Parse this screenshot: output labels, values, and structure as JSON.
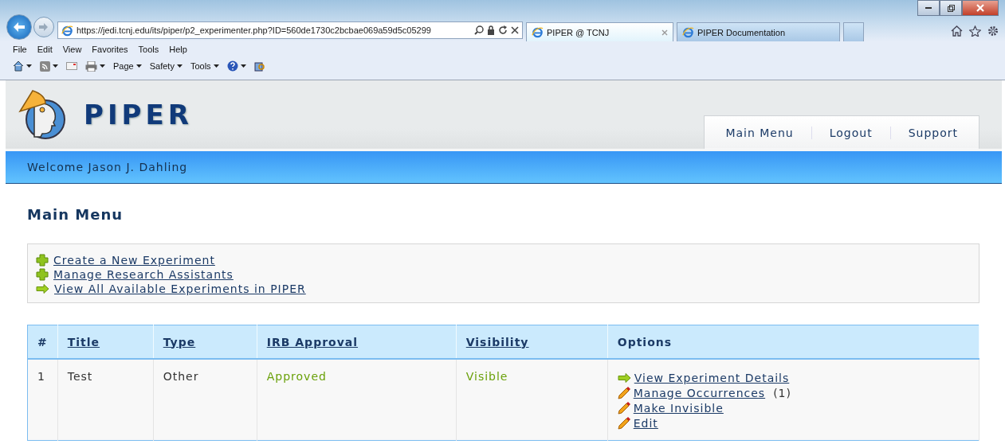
{
  "browser": {
    "address": "https://jedi.tcnj.edu/its/piper/p2_experimenter.php?ID=560de1730c2bcbae069a59d5c05299",
    "tabs": [
      {
        "label": "PIPER @ TCNJ",
        "selected": true
      },
      {
        "label": "PIPER Documentation",
        "selected": false
      }
    ],
    "menu": [
      "File",
      "Edit",
      "View",
      "Favorites",
      "Tools",
      "Help"
    ],
    "commands": [
      "Page",
      "Safety",
      "Tools"
    ]
  },
  "site": {
    "logo": "PIPER",
    "nav": [
      "Main Menu",
      "Logout",
      "Support"
    ],
    "welcome": "Welcome Jason J. Dahling",
    "heading": "Main Menu",
    "quick_links": [
      {
        "kind": "plus",
        "label": "Create a New Experiment"
      },
      {
        "kind": "plus",
        "label": "Manage Research Assistants"
      },
      {
        "kind": "arrow",
        "label": "View All Available Experiments in PIPER"
      }
    ],
    "table": {
      "columns": [
        {
          "label": "#",
          "sortable": false
        },
        {
          "label": "Title",
          "sortable": true
        },
        {
          "label": "Type",
          "sortable": true
        },
        {
          "label": "IRB Approval",
          "sortable": true
        },
        {
          "label": "Visibility",
          "sortable": true
        },
        {
          "label": "Options",
          "sortable": false
        }
      ],
      "rows": [
        {
          "number": "1",
          "title": "Test",
          "type": "Other",
          "irb": "Approved",
          "visibility": "Visible",
          "options": [
            {
              "kind": "arrow",
              "label": "View Experiment Details"
            },
            {
              "kind": "pencil",
              "label": "Manage Occurrences",
              "count": "(1)"
            },
            {
              "kind": "pencil",
              "label": "Make Invisible"
            },
            {
              "kind": "pencil",
              "label": "Edit"
            }
          ]
        }
      ]
    }
  }
}
